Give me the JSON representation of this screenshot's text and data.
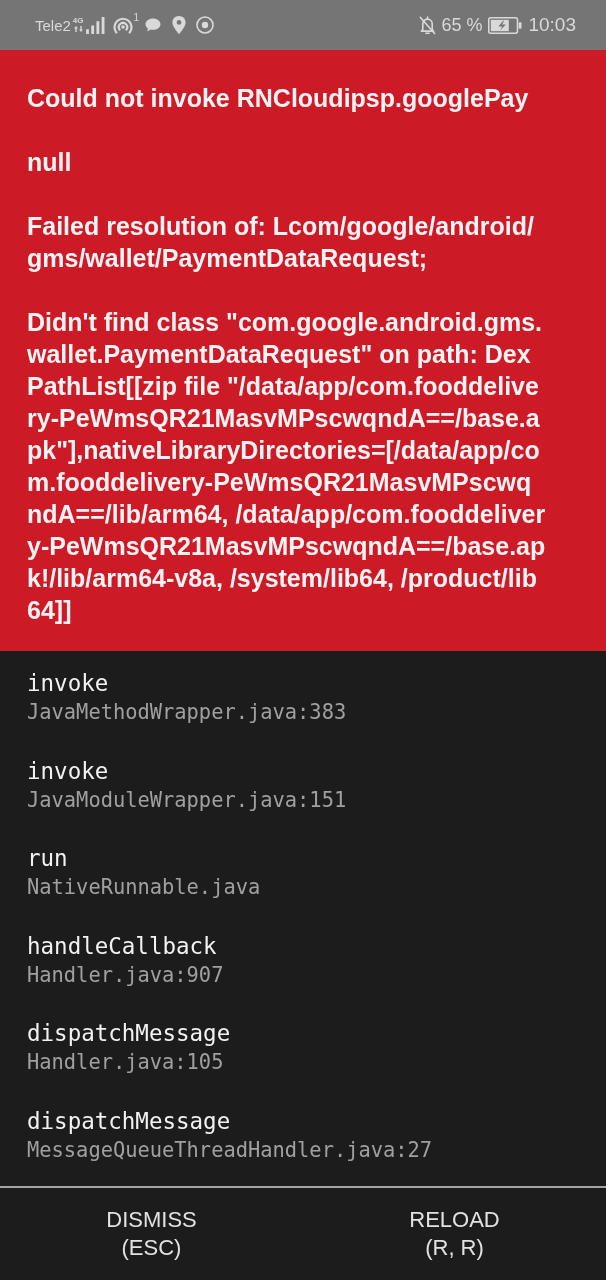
{
  "status_bar": {
    "carrier": "Tele2",
    "network_type": "4G",
    "notification_count": "1",
    "battery_percent": "65 %",
    "time": "10:03"
  },
  "error": {
    "paragraphs": [
      "Could not invoke RNCloudipsp.googlePay",
      "null",
      "Failed resolution of: Lcom/google/android/gms/wallet/PaymentDataRequest;",
      "Didn't find class \"com.google.android.gms.wallet.PaymentDataRequest\" on path: DexPathList[[zip file \"/data/app/com.fooddelivery-PeWmsQR21MasvMPscwqndA==/base.apk\"],nativeLibraryDirectories=[/data/app/com.fooddelivery-PeWmsQR21MasvMPscwqndA==/lib/arm64, /data/app/com.fooddelivery-PeWmsQR21MasvMPscwqndA==/base.apk!/lib/arm64-v8a, /system/lib64, /product/lib64]]"
    ]
  },
  "stack_trace": [
    {
      "method": "invoke",
      "location": "JavaMethodWrapper.java:383"
    },
    {
      "method": "invoke",
      "location": "JavaModuleWrapper.java:151"
    },
    {
      "method": "run",
      "location": "NativeRunnable.java"
    },
    {
      "method": "handleCallback",
      "location": "Handler.java:907"
    },
    {
      "method": "dispatchMessage",
      "location": "Handler.java:105"
    },
    {
      "method": "dispatchMessage",
      "location": "MessageQueueThreadHandler.java:27"
    }
  ],
  "buttons": [
    {
      "label": "DISMISS",
      "shortcut": "(ESC)"
    },
    {
      "label": "RELOAD",
      "shortcut": "(R, R)"
    }
  ]
}
